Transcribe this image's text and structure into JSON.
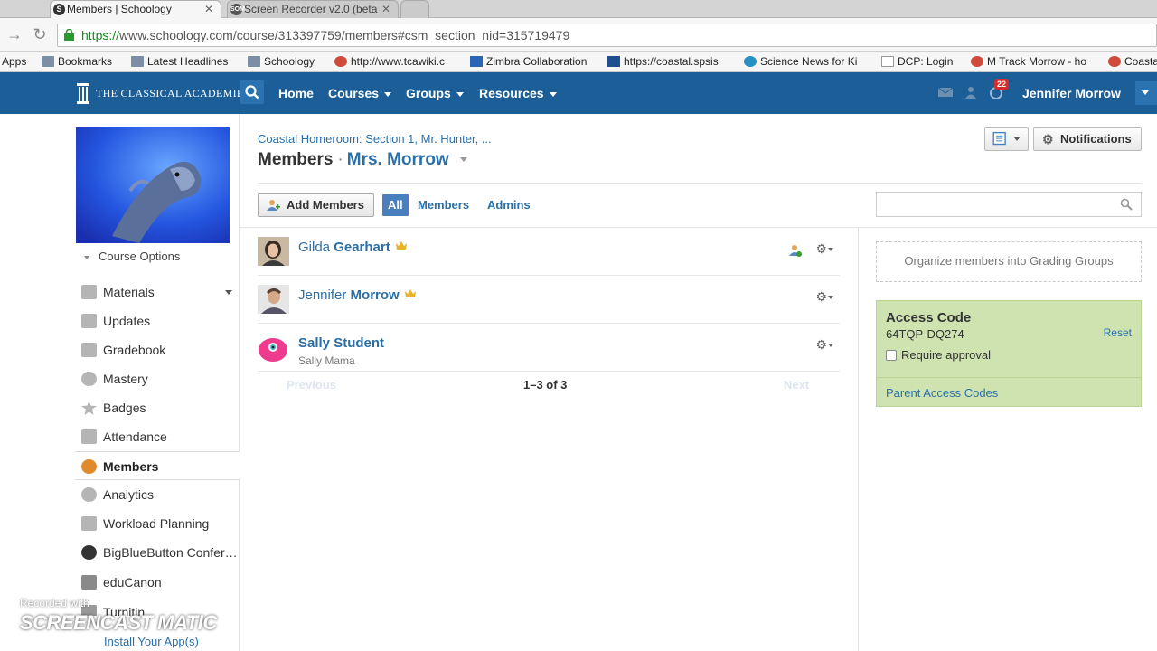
{
  "browser": {
    "tabs": [
      {
        "title": "Members | Schoology",
        "active": true
      },
      {
        "title": "Screen Recorder v2.0 (beta",
        "active": false
      }
    ],
    "url_scheme": "https://",
    "url_rest": "www.schoology.com/course/313397759/members#csm_section_nid=315719479",
    "bookmarks": [
      "Apps",
      "Bookmarks",
      "Latest Headlines",
      "Schoology",
      "http://www.tcawiki.c",
      "Zimbra Collaboration",
      "https://coastal.spsis",
      "Science News for Ki",
      "DCP: Login",
      "M Track Morrow - ho",
      "Coasta"
    ]
  },
  "header": {
    "logo_text": "THE CLASSICAL ACADEMIES",
    "nav": [
      "Home",
      "Courses",
      "Groups",
      "Resources"
    ],
    "notification_count": "22",
    "user_name": "Jennifer Morrow",
    "brand_color": "#1c5f98"
  },
  "sidebar": {
    "course_options": "Course Options",
    "items": [
      {
        "label": "Materials",
        "icon": "materials-icon"
      },
      {
        "label": "Updates",
        "icon": "updates-icon"
      },
      {
        "label": "Gradebook",
        "icon": "gradebook-icon"
      },
      {
        "label": "Mastery",
        "icon": "mastery-icon"
      },
      {
        "label": "Badges",
        "icon": "badges-icon"
      },
      {
        "label": "Attendance",
        "icon": "attendance-icon"
      },
      {
        "label": "Members",
        "icon": "members-icon",
        "active": true
      },
      {
        "label": "Analytics",
        "icon": "analytics-icon"
      },
      {
        "label": "Workload Planning",
        "icon": "workload-icon"
      },
      {
        "label": "BigBlueButton Confer…",
        "icon": "bigbluebutton-icon"
      },
      {
        "label": "eduCanon",
        "icon": "educanon-icon"
      },
      {
        "label": "Turnitin",
        "icon": "turnitin-icon"
      }
    ],
    "install_apps": "Install Your App(s)"
  },
  "watermark": {
    "line1": "Recorded with",
    "line2": "SCREENCAST  MATIC"
  },
  "main": {
    "breadcrumb": "Coastal Homeroom: Section 1, Mr. Hunter, ...",
    "title": "Members",
    "title_sep": "·",
    "title_owner": "Mrs. Morrow",
    "notifications_label": "Notifications",
    "add_members_label": "Add Members",
    "filters": [
      "All",
      "Members",
      "Admins"
    ],
    "search_placeholder": "",
    "members": [
      {
        "first": "Gilda",
        "last": "Gearhart",
        "admin": true,
        "sub": ""
      },
      {
        "first": "Jennifer",
        "last": "Morrow",
        "admin": true,
        "sub": ""
      },
      {
        "first": "Sally",
        "last": "Student",
        "admin": false,
        "sub": "Sally Mama"
      }
    ],
    "pager": {
      "prev": "Previous",
      "count": "1–3 of 3",
      "next": "Next"
    },
    "grading_groups": "Organize members into Grading Groups",
    "access": {
      "heading": "Access Code",
      "code": "64TQP-DQ274",
      "reset": "Reset",
      "require_approval": "Require approval",
      "parent_codes": "Parent Access Codes"
    }
  }
}
